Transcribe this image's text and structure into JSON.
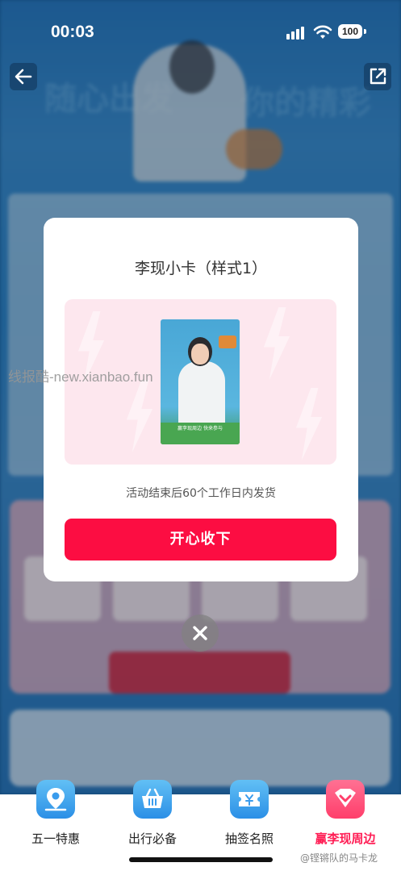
{
  "status_bar": {
    "time": "00:03",
    "battery": "100"
  },
  "background": {
    "hero_left": "随心出发",
    "hero_right": "你的精彩"
  },
  "modal": {
    "title": "李现小卡（样式1）",
    "card_caption": "赢李现周边 快来参与",
    "note": "活动结束后60个工作日内发货",
    "confirm_label": "开心收下"
  },
  "watermark": "线报酷-new.xianbao.fun",
  "tabbar": {
    "items": [
      {
        "label": "五一特惠",
        "icon": "map-pin-icon",
        "active": false
      },
      {
        "label": "出行必备",
        "icon": "basket-icon",
        "active": false
      },
      {
        "label": "抽签名照",
        "icon": "ticket-icon",
        "active": false
      },
      {
        "label": "赢李现周边",
        "icon": "heart-icon",
        "active": true
      }
    ]
  },
  "weibo_watermark": "@铿锵队的马卡龙",
  "colors": {
    "accent": "#fc0d42",
    "tab_active": "#ff1e55",
    "tab_icon": "#2b8fe6"
  }
}
